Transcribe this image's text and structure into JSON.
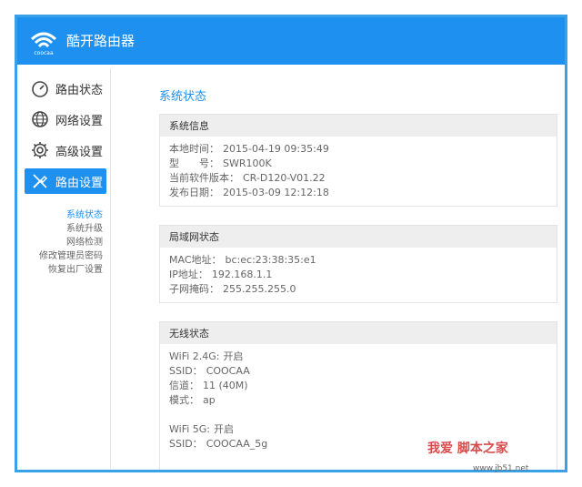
{
  "app": {
    "title": "酷开路由器",
    "logo_text": "coocaa"
  },
  "sidebar": {
    "items": [
      {
        "label": "路由状态",
        "icon": "gauge-icon",
        "active": false
      },
      {
        "label": "网络设置",
        "icon": "globe-icon",
        "active": false
      },
      {
        "label": "高级设置",
        "icon": "gear-icon",
        "active": false
      },
      {
        "label": "路由设置",
        "icon": "tools-icon",
        "active": true
      }
    ],
    "subitems": [
      {
        "label": "系统状态",
        "active": true
      },
      {
        "label": "系统升级",
        "active": false
      },
      {
        "label": "网络检测",
        "active": false
      },
      {
        "label": "修改管理员密码",
        "active": false
      },
      {
        "label": "恢复出厂设置",
        "active": false
      }
    ]
  },
  "main": {
    "title": "系统状态",
    "system_info": {
      "title": "系统信息",
      "rows": [
        {
          "k": "本地时间：",
          "v": "2015-04-19 09:35:49"
        },
        {
          "k": "型　　号：",
          "v": "SWR100K"
        },
        {
          "k": "当前软件版本：",
          "v": "CR-D120-V01.22"
        },
        {
          "k": "发布日期：",
          "v": "2015-03-09 12:12:18"
        }
      ]
    },
    "lan_status": {
      "title": "局域网状态",
      "rows": [
        {
          "k": "MAC地址：",
          "v": "bc:ec:23:38:35:e1"
        },
        {
          "k": "IP地址：",
          "v": "192.168.1.1"
        },
        {
          "k": "子网掩码：",
          "v": "255.255.255.0"
        }
      ]
    },
    "wireless_status": {
      "title": "无线状态",
      "rows": [
        {
          "k": "WiFi 2.4G:",
          "v": "开启"
        },
        {
          "k": "SSID：",
          "v": "COOCAA"
        },
        {
          "k": "信道：",
          "v": "11 (40M)"
        },
        {
          "k": "模式：",
          "v": "ap"
        },
        {
          "k": "",
          "v": ""
        },
        {
          "k": "WiFi 5G:",
          "v": "开启"
        },
        {
          "k": "SSID：",
          "v": "COOCAA_5g"
        }
      ]
    }
  },
  "watermark": {
    "main": "我爱 脚本之家",
    "sub": "www.jb51.net"
  },
  "colors": {
    "accent": "#1e90f0",
    "frame_border": "#3aa0e8"
  }
}
